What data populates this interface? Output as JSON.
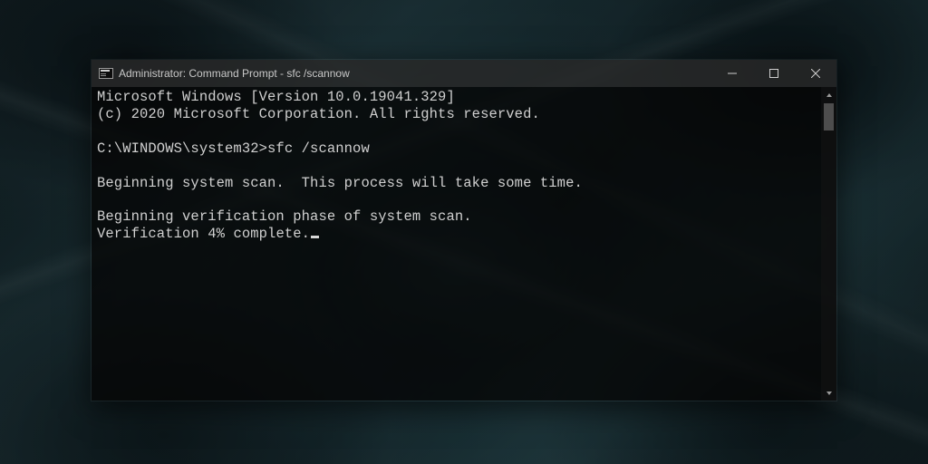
{
  "window": {
    "title": "Administrator: Command Prompt - sfc  /scannow",
    "icon": "cmd-icon"
  },
  "terminal": {
    "header_version": "Microsoft Windows [Version 10.0.19041.329]",
    "header_copyright": "(c) 2020 Microsoft Corporation. All rights reserved.",
    "prompt": "C:\\WINDOWS\\system32>",
    "command": "sfc /scannow",
    "msg_begin_scan": "Beginning system scan.  This process will take some time.",
    "msg_begin_verify": "Beginning verification phase of system scan.",
    "progress_prefix": "Verification ",
    "progress_percent": "4%",
    "progress_suffix": " complete."
  },
  "controls": {
    "minimize": "Minimize",
    "maximize": "Maximize",
    "close": "Close"
  }
}
